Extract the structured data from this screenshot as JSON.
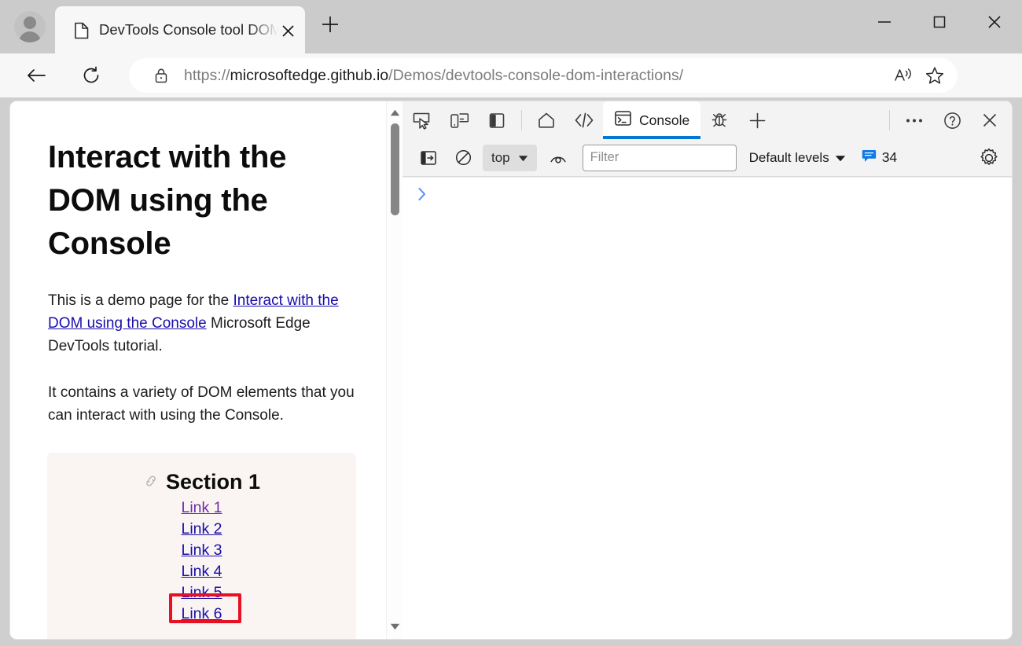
{
  "window": {
    "controls": {
      "minimize": "minimize-button",
      "maximize": "maximize-button",
      "close": "close-button"
    }
  },
  "browser": {
    "tab": {
      "title": "DevTools Console tool DOM inte",
      "favicon": "page-icon",
      "close_label": "×"
    },
    "new_tab_label": "+",
    "toolbar": {
      "back": "back-arrow-icon",
      "reload": "reload-icon",
      "lock": "lock-icon",
      "read_aloud": "read-aloud-icon",
      "favorite": "star-icon",
      "settings_more": "ellipsis-icon"
    },
    "omnibox": {
      "scheme": "https://",
      "host": "microsoftedge.github.io",
      "path": "/Demos/devtools-console-dom-interactions/"
    }
  },
  "page": {
    "heading": "Interact with the DOM using the Console",
    "paragraph1_before": "This is a demo page for the ",
    "paragraph1_link": "Interact with the DOM using the Console",
    "paragraph1_after": " Microsoft Edge DevTools tutorial.",
    "paragraph2": "It contains a variety of DOM elements that you can interact with using the Console.",
    "section": {
      "anchor_icon": "link-anchor-icon",
      "title": "Section 1",
      "links": [
        {
          "label": "Link 1",
          "state": "visited",
          "highlighted": true
        },
        {
          "label": "Link 2",
          "state": "unvisited",
          "highlighted": false
        },
        {
          "label": "Link 3",
          "state": "unvisited",
          "highlighted": false
        },
        {
          "label": "Link 4",
          "state": "unvisited",
          "highlighted": false
        },
        {
          "label": "Link 5",
          "state": "unvisited",
          "highlighted": false
        },
        {
          "label": "Link 6",
          "state": "unvisited",
          "highlighted": false
        }
      ],
      "background_color": "#faf5f3",
      "highlight_color": "#e81123"
    },
    "scrollbar": {
      "up_arrow": "scroll-up-arrow-icon",
      "down_arrow": "scroll-down-arrow-icon"
    }
  },
  "devtools": {
    "toolbar": {
      "inspect": "inspect-element-icon",
      "device_emulation": "device-emulation-icon",
      "dock_side": "dock-side-icon",
      "welcome": "home-icon",
      "elements": "elements-code-icon",
      "console_tab_label": "Console",
      "console_tab_icon": "console-terminal-icon",
      "issues": "bug-icon",
      "more_tools": "+",
      "overflow": "ellipsis-icon",
      "help": "help-question-icon",
      "close": "close-x-icon"
    },
    "filterbar": {
      "sidebar_toggle": "console-sidebar-icon",
      "clear_console": "clear-console-icon",
      "context_label": "top",
      "context_chevron": "chevron-down-icon",
      "live_expression": "eye-live-expression-icon",
      "filter_placeholder": "Filter",
      "filter_value": "",
      "levels_label": "Default levels",
      "levels_chevron": "chevron-down-icon",
      "message_icon": "message-bubble-icon",
      "message_count": "34",
      "settings": "gear-icon",
      "accent_color": "#0078d4"
    },
    "console": {
      "prompt_caret": ">",
      "input_value": ""
    }
  }
}
